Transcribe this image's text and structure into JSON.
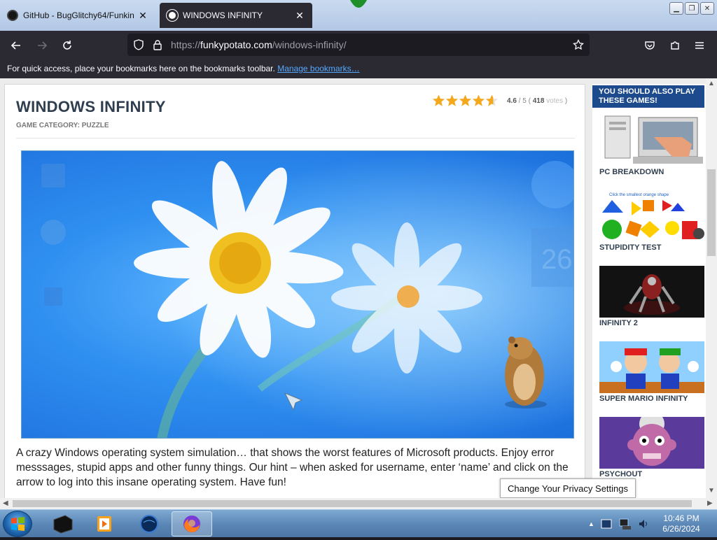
{
  "tabs": [
    {
      "title": "GitHub - BugGlitchy64/Funkin",
      "close": "✕"
    },
    {
      "title": "WINDOWS INFINITY",
      "close": "✕"
    }
  ],
  "address": {
    "protocol": "https://",
    "domain": "funkypotato.com",
    "path": "/windows-infinity/"
  },
  "bookmarks_bar": {
    "message": "For quick access, place your bookmarks here on the bookmarks toolbar.",
    "link": "Manage bookmarks…"
  },
  "game": {
    "title": "WINDOWS INFINITY",
    "category": "GAME CATEGORY: PUZZLE",
    "rating": {
      "score": "4.6",
      "max": "5",
      "votes": "418",
      "votes_label": "votes",
      "stars_value": 4.6
    },
    "screenshot_text": {
      "date_number": "26"
    },
    "description": "A crazy Windows operating system simulation… that shows the worst features of Microsoft products. Enjoy error messsages, stupid apps and other funny things. Our hint – when asked for username, enter ‘name’ and click on the arrow to log into this insane operating system. Have fun!"
  },
  "sidebar": {
    "heading": "YOU SHOULD ALSO PLAY THESE GAMES!",
    "games": [
      {
        "label": "PC BREAKDOWN"
      },
      {
        "label": "STUPIDITY TEST",
        "thumb_text": "Click the smallest orange shape"
      },
      {
        "label": "INFINITY 2"
      },
      {
        "label": "SUPER MARIO INFINITY"
      },
      {
        "label": "PSYCHOUT"
      }
    ]
  },
  "privacy_button": "Change Your Privacy Settings",
  "taskbar": {
    "time": "10:46 PM",
    "date": "6/26/2024"
  },
  "colors": {
    "accent": "#1c4a8c",
    "star": "#f4a81c",
    "browser_dark": "#2b2a33",
    "link": "#54a8ff"
  }
}
